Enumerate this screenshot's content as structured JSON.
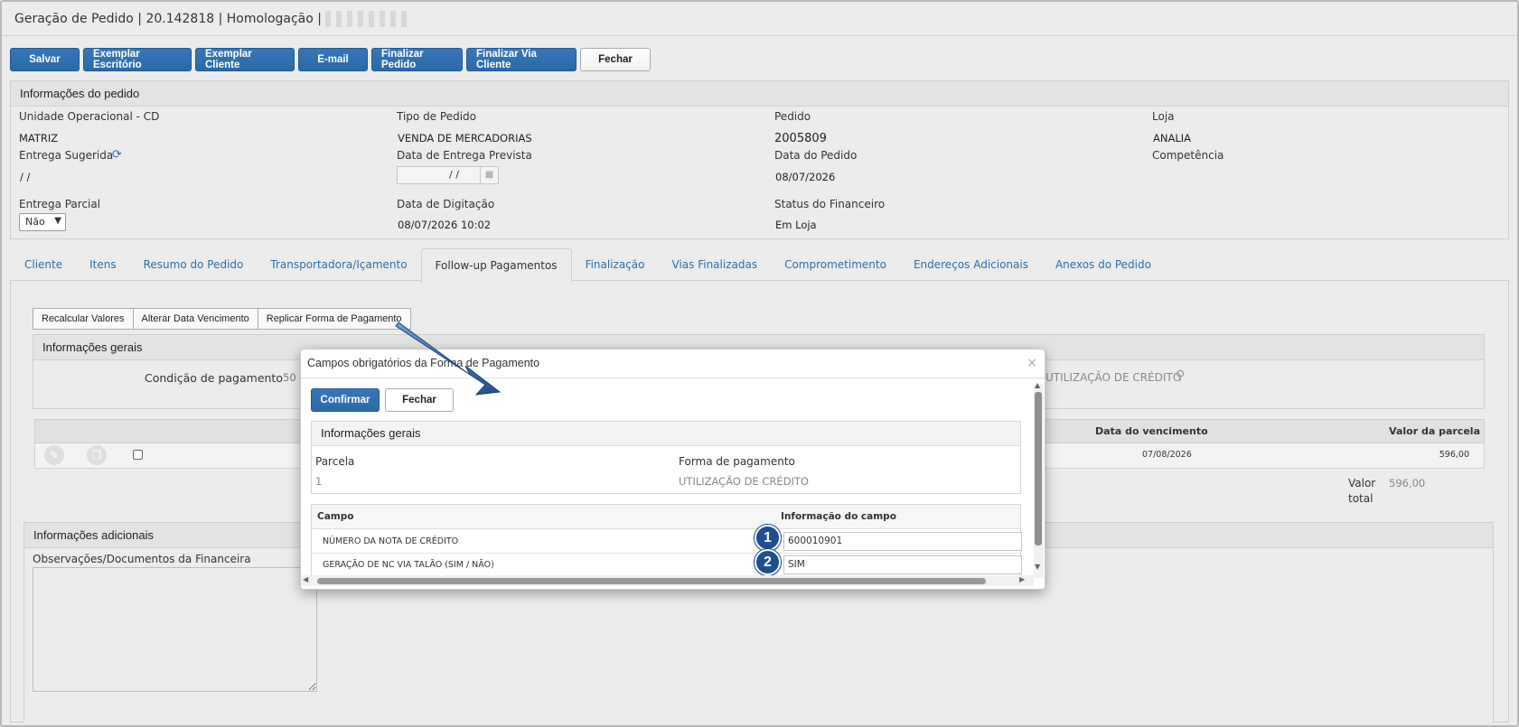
{
  "title": {
    "text": "Geração de Pedido | 20.142818 | Homologação |"
  },
  "toolbar": [
    "Salvar",
    "Exemplar Escritório",
    "Exemplar Cliente",
    "E-mail",
    "Finalizar Pedido",
    "Finalizar Via Cliente",
    "Fechar"
  ],
  "pedido": {
    "header": "Informações do pedido",
    "unidade_label": "Unidade Operacional - CD",
    "unidade_value": "MATRIZ",
    "tipo_label": "Tipo de Pedido",
    "tipo_value": "VENDA DE MERCADORIAS",
    "pedido_label": "Pedido",
    "pedido_value": "2005809",
    "loja_label": "Loja",
    "loja_value": "ANALIA",
    "entrega_sug_label": "Entrega Sugerida",
    "entrega_sug_value": "/ /",
    "data_prev_label": "Data de Entrega Prevista",
    "data_prev_value": "/ /",
    "data_pedido_label": "Data do Pedido",
    "data_pedido_value": "08/07/2026",
    "competencia_label": "Competência",
    "entrega_parcial_label": "Entrega Parcial",
    "entrega_parcial_value": "Não",
    "data_dig_label": "Data de Digitação",
    "data_dig_value": "08/07/2026 10:02",
    "status_fin_label": "Status do Financeiro",
    "status_fin_value": "Em Loja"
  },
  "tabs": [
    "Cliente",
    "Itens",
    "Resumo do Pedido",
    "Transportadora/Içamento",
    "Follow-up Pagamentos",
    "Finalização",
    "Vias Finalizadas",
    "Comprometimento",
    "Endereços Adicionais",
    "Anexos do Pedido"
  ],
  "subtoolbar": [
    "Recalcular Valores",
    "Alterar Data Vencimento",
    "Replicar Forma de Pagamento"
  ],
  "info_gerais": {
    "header": "Informações gerais",
    "condicao_label": "Condição de pagamento",
    "condicao_value": "50",
    "forma_value": "UTILIZAÇÃO DE CRÉDITO"
  },
  "grid": {
    "col_vencimento": "Data do vencimento",
    "col_valor": "Valor da parcela",
    "row_vencimento": "07/08/2026",
    "row_valor": "596,00",
    "total_label_1": "Valor",
    "total_label_2": "total",
    "total_value": "596,00"
  },
  "adicionais": {
    "header": "Informações adicionais",
    "obs_label": "Observações/Documentos da Financeira"
  },
  "modal": {
    "title": "Campos obrigatórios da Forma de Pagamento",
    "confirm": "Confirmar",
    "close": "Fechar",
    "section_header": "Informações gerais",
    "parcela_label": "Parcela",
    "parcela_value": "1",
    "forma_label": "Forma de pagamento",
    "forma_value": "UTILIZAÇÃO DE CRÉDITO",
    "col_campo": "Campo",
    "col_info": "Informação do campo",
    "rows": [
      {
        "campo": "NÚMERO DA NOTA DE CRÉDITO",
        "valor": "600010901",
        "badge": "1"
      },
      {
        "campo": "GERAÇÃO DE NC VIA TALÃO (SIM / NÃO)",
        "valor": "SIM",
        "badge": "2"
      }
    ]
  },
  "colors": {
    "primary": "#2c6aa6",
    "badge": "#1e4f8c",
    "link": "#2d6ea7"
  }
}
